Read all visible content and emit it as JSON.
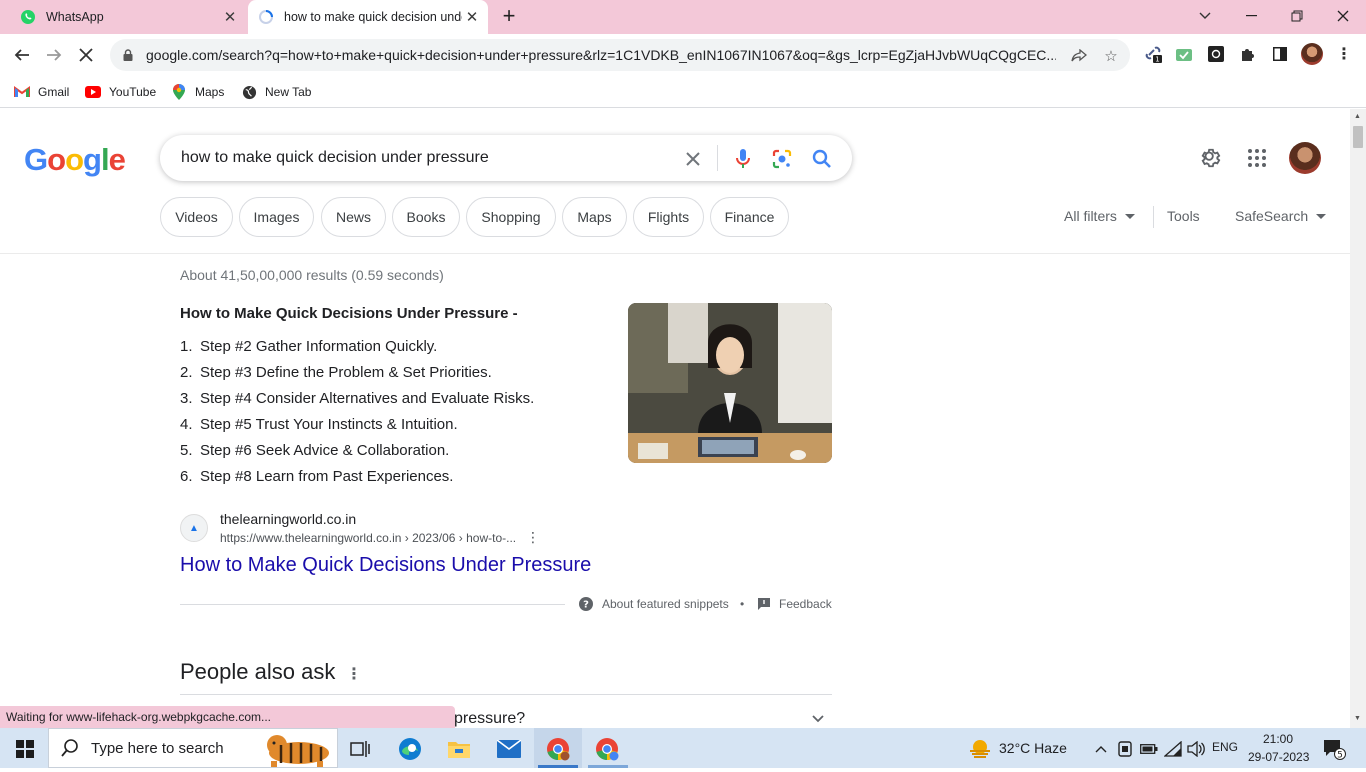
{
  "browser": {
    "tabs": [
      {
        "title": "WhatsApp",
        "icon": "whatsapp-icon"
      },
      {
        "title": "how to make quick decision unde",
        "icon": "loading-icon"
      }
    ],
    "url": "google.com/search?q=how+to+make+quick+decision+under+pressure&rlz=1C1VDKB_enIN1067IN1067&oq=&gs_lcrp=EgZjaHJvbWUqCQgCEC...",
    "extension_badge": "1",
    "bookmarks": [
      "Gmail",
      "YouTube",
      "Maps",
      "New Tab"
    ]
  },
  "search": {
    "logo": "Google",
    "query": "how to make quick decision under pressure",
    "chips": [
      "Videos",
      "Images",
      "News",
      "Books",
      "Shopping",
      "Maps",
      "Flights",
      "Finance"
    ],
    "all_filters": "All filters",
    "tools": "Tools",
    "safesearch": "SafeSearch"
  },
  "results": {
    "stats": "About 41,50,00,000 results (0.59 seconds)",
    "snippet_title": "How to Make Quick Decisions Under Pressure -",
    "steps": [
      {
        "n": "1.",
        "text": "Step #2 Gather Information Quickly."
      },
      {
        "n": "2.",
        "text": "Step #3 Define the Problem & Set Priorities."
      },
      {
        "n": "3.",
        "text": "Step #4 Consider Alternatives and Evaluate Risks."
      },
      {
        "n": "4.",
        "text": "Step #5 Trust Your Instincts & Intuition."
      },
      {
        "n": "5.",
        "text": "Step #6 Seek Advice & Collaboration."
      },
      {
        "n": "6.",
        "text": "Step #8 Learn from Past Experiences."
      }
    ],
    "source_name": "thelearningworld.co.in",
    "source_url": "https://www.thelearningworld.co.in › 2023/06 › how-to-...",
    "result_link": "How to Make Quick Decisions Under Pressure",
    "about_snippets": "About featured snippets",
    "bullet": "•",
    "feedback": "Feedback",
    "paa_title": "People also ask",
    "paa_partial": "pressure?"
  },
  "status_bar": "Waiting for www-lifehack-org.webpkgcache.com...",
  "taskbar": {
    "search_placeholder": "Type here to search",
    "weather": "32°C  Haze",
    "lang": "ENG",
    "time": "21:00",
    "date": "29-07-2023",
    "notif_count": "5"
  }
}
